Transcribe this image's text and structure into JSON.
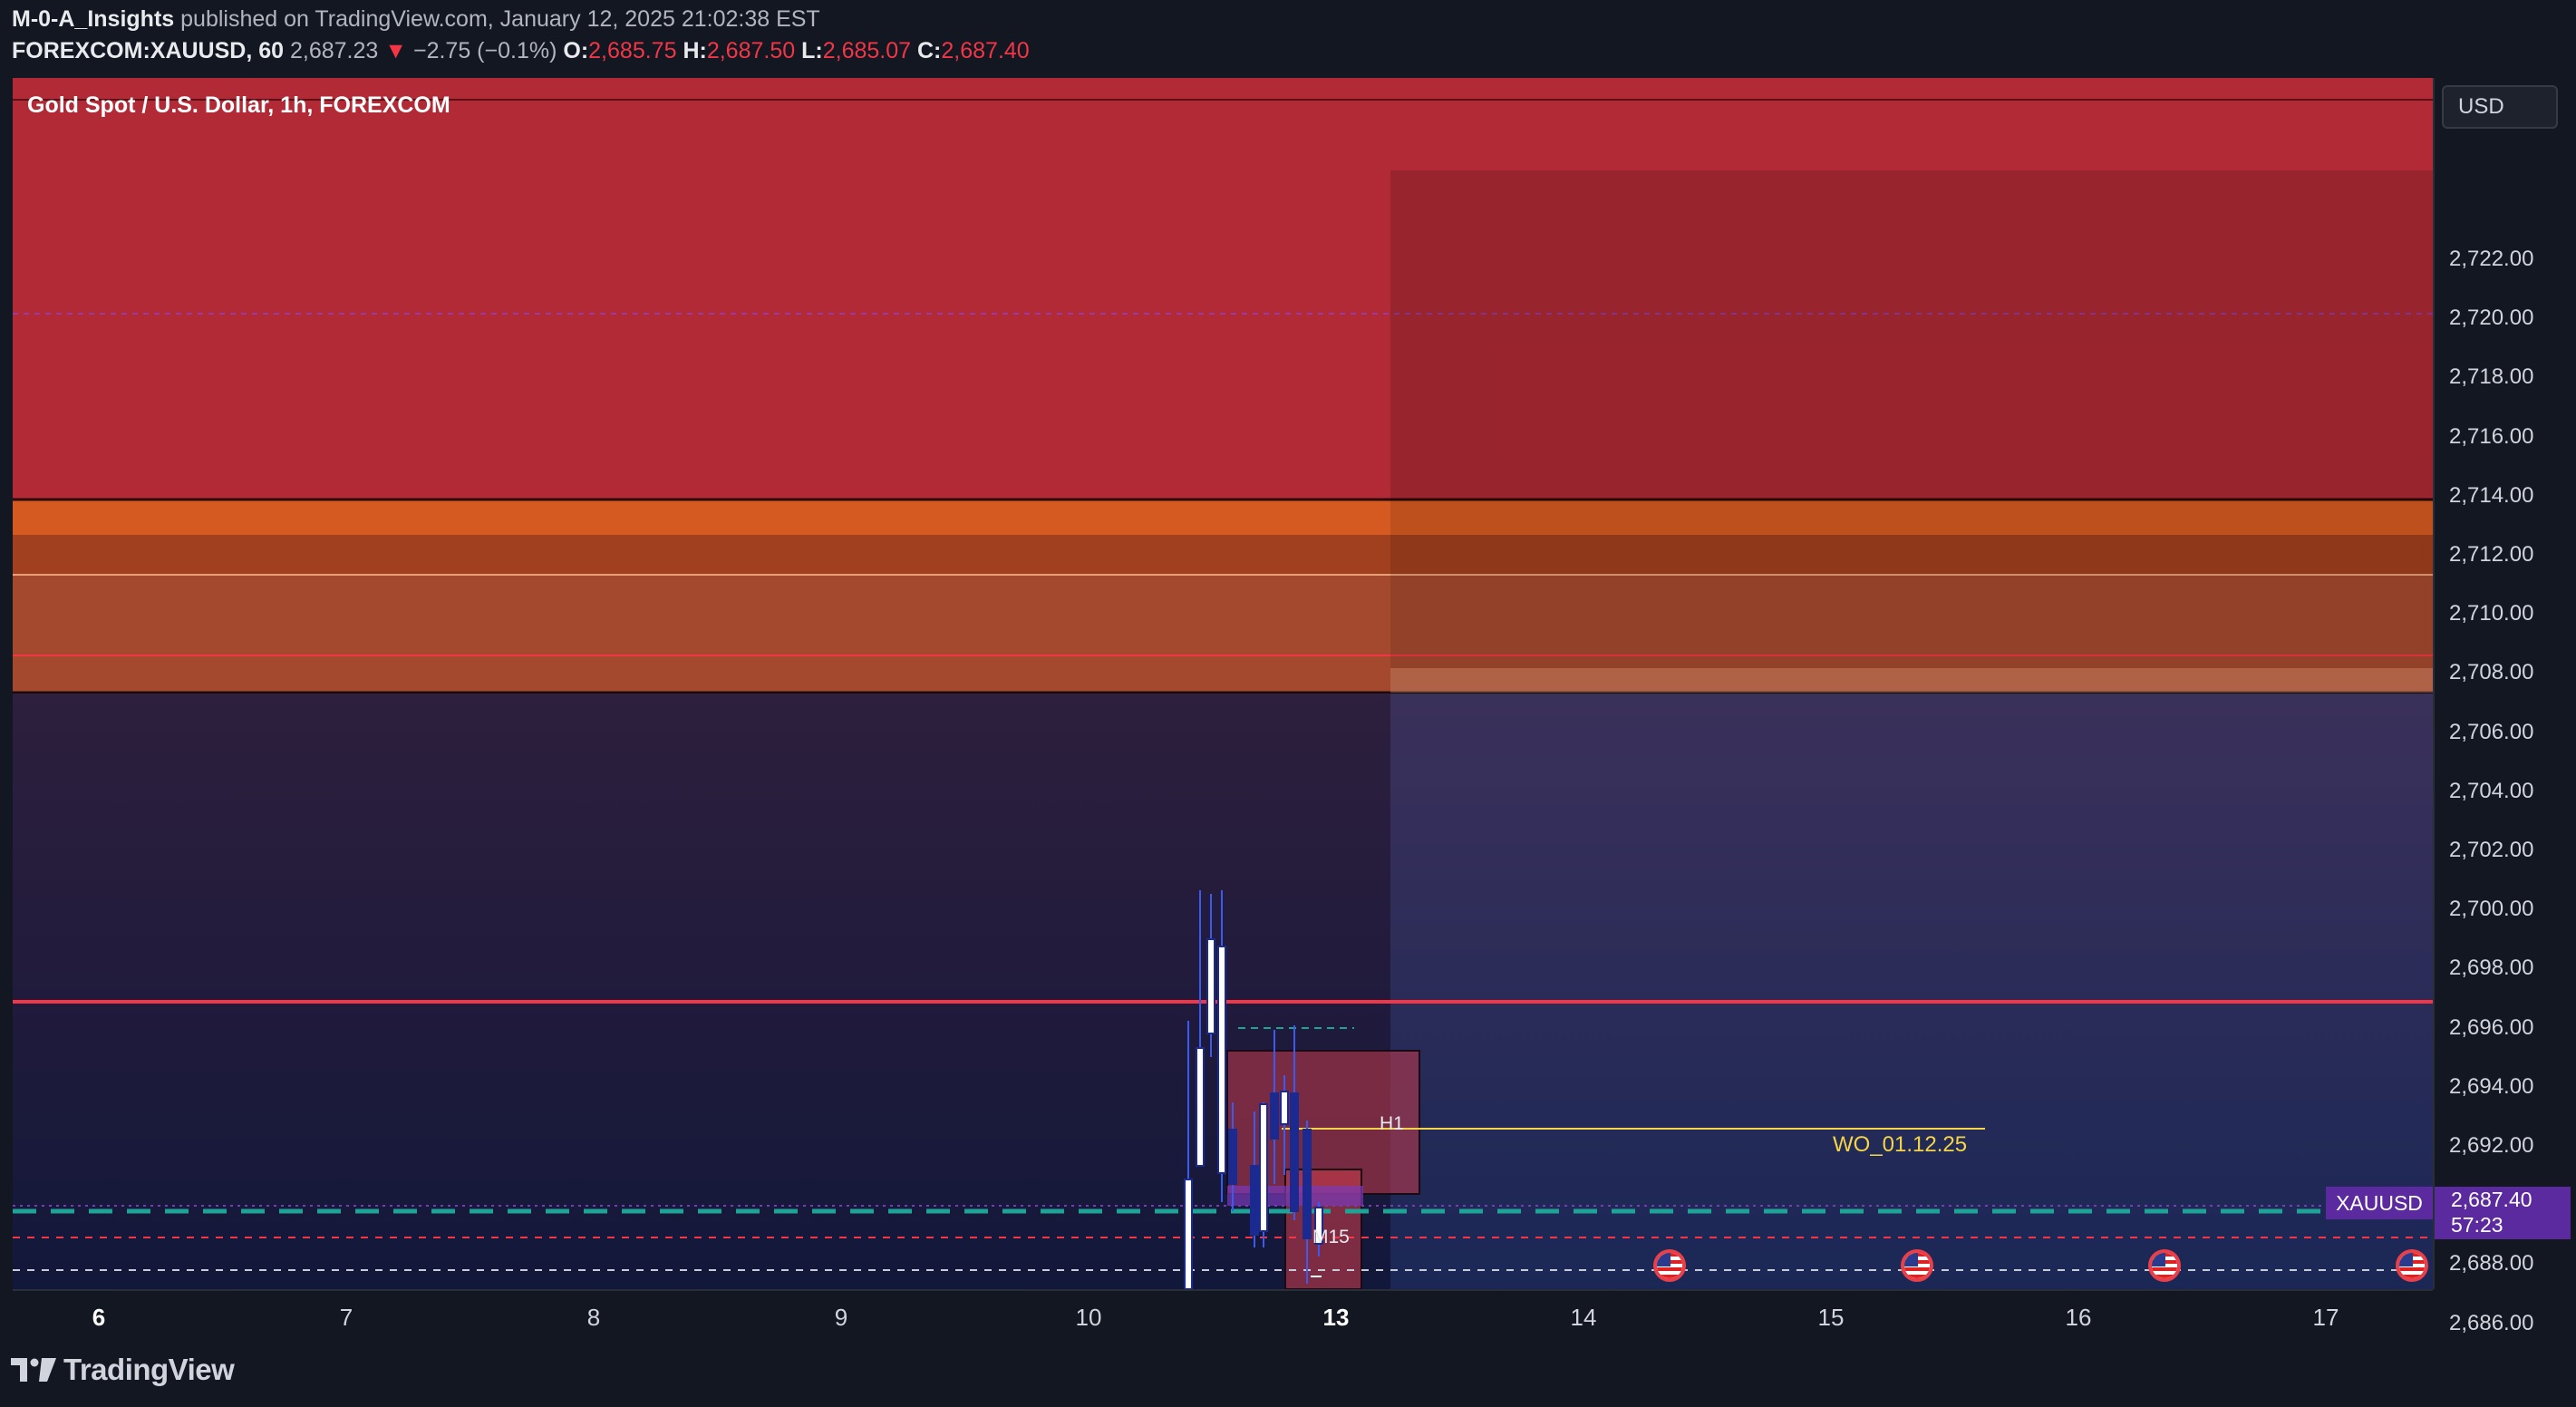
{
  "header": {
    "author": "M-0-A_Insights",
    "published_text": "published on TradingView.com, January 12, 2025 21:02:38 EST",
    "symbol": "FOREXCOM:XAUUSD, 60",
    "last_price": "2,687.23",
    "change_arrow": "▼",
    "change": "−2.75 (−0.1%)",
    "open_label": "O:",
    "open": "2,685.75",
    "high_label": "H:",
    "high": "2,687.50",
    "low_label": "L:",
    "low": "2,685.07",
    "close_label": "C:",
    "close": "2,687.40"
  },
  "chart": {
    "symbol_title": "Gold Spot / U.S. Dollar, 1h, FOREXCOM",
    "label_h1": "H1",
    "label_m15": "M15",
    "label_wo": "WO_01.12.25",
    "colors": {
      "supply_zone": "#b22a36",
      "orange_band": "#c4502a",
      "discount_zone": "#2a2a55",
      "current_price": "#5b2a9e",
      "teal_line": "#1fa396",
      "red_line": "#f23645",
      "yellow_line": "#f5d547"
    }
  },
  "price_axis": {
    "currency": "USD",
    "ticks": [
      "2,722.00",
      "2,720.00",
      "2,718.00",
      "2,716.00",
      "2,714.00",
      "2,712.00",
      "2,710.00",
      "2,708.00",
      "2,706.00",
      "2,704.00",
      "2,702.00",
      "2,700.00",
      "2,698.00",
      "2,696.00",
      "2,694.00",
      "2,692.00",
      "2,690.00",
      "2,688.00",
      "2,686.00"
    ],
    "current_price": "2,687.40",
    "countdown": "57:23",
    "symbol_tag": "XAUUSD"
  },
  "time_axis": {
    "ticks": [
      {
        "label": "6",
        "bold": true
      },
      {
        "label": "7",
        "bold": false
      },
      {
        "label": "8",
        "bold": false
      },
      {
        "label": "9",
        "bold": false
      },
      {
        "label": "10",
        "bold": false
      },
      {
        "label": "13",
        "bold": true
      },
      {
        "label": "14",
        "bold": false
      },
      {
        "label": "15",
        "bold": false
      },
      {
        "label": "16",
        "bold": false
      },
      {
        "label": "17",
        "bold": false
      }
    ]
  },
  "events": {
    "icon": "us-flag-icon",
    "count": 4
  },
  "footer": {
    "brand": "TradingView"
  }
}
